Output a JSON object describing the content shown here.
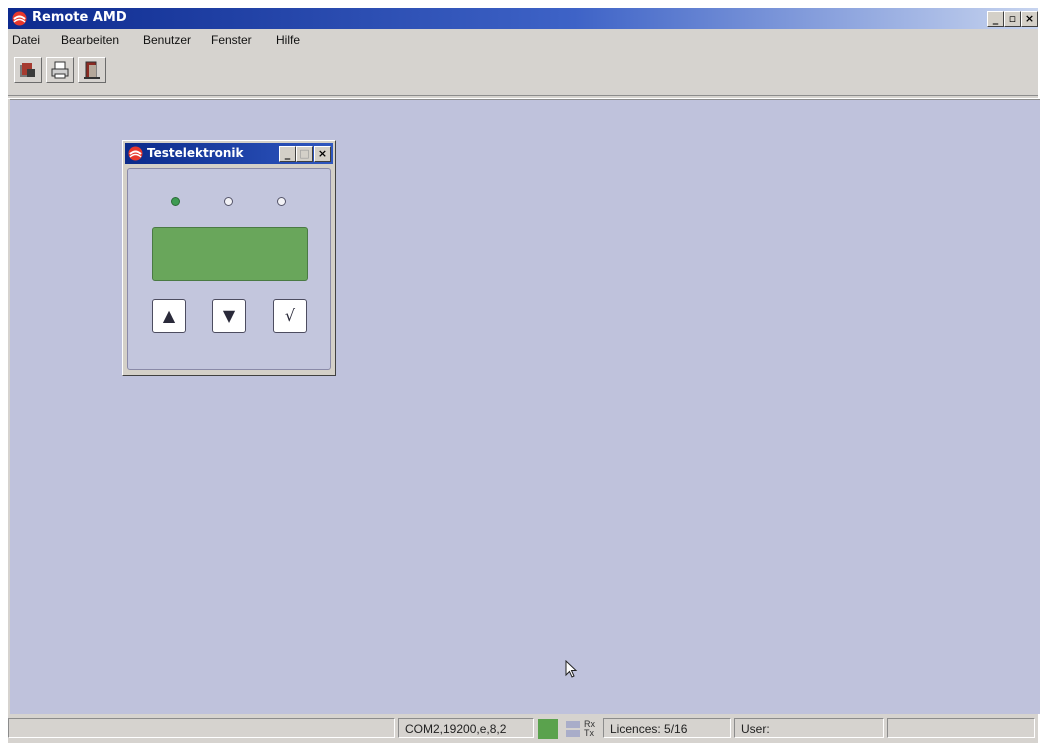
{
  "window": {
    "title": "Remote AMD",
    "controls": {
      "minimize": "_",
      "restore": "▫",
      "close": "×"
    }
  },
  "menu": [
    "Datei",
    "Bearbeiten",
    "Benutzer",
    "Fenster",
    "Hilfe"
  ],
  "toolbar": {
    "buttons": [
      "connect-icon",
      "print-icon",
      "exit-icon"
    ]
  },
  "child_window": {
    "title": "Testelektronik",
    "leds": [
      {
        "state": "on"
      },
      {
        "state": "off"
      },
      {
        "state": "off"
      }
    ],
    "buttons": {
      "up": "▲",
      "down": "▼",
      "confirm": "√"
    },
    "lcd_text": ""
  },
  "statusbar": {
    "connection": "COM2,19200,e,8,2",
    "rx": "Rx",
    "tx": "Tx",
    "licences": "Licences: 5/16",
    "user": "User:",
    "colors": {
      "indicator": "#5aa24d"
    }
  }
}
